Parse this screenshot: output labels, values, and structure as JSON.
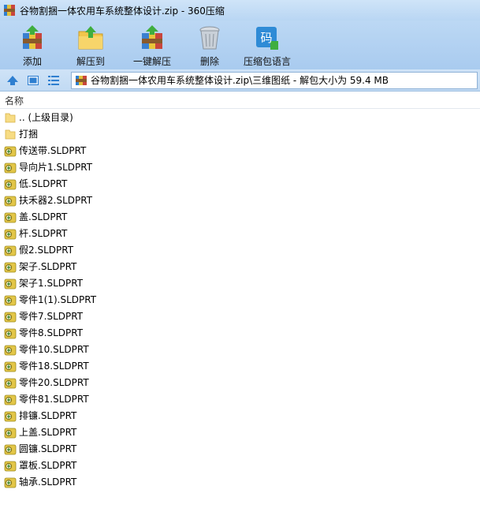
{
  "window": {
    "title": "谷物割捆一体农用车系统整体设计.zip - 360压缩"
  },
  "toolbar": {
    "buttons": [
      {
        "label": "添加",
        "icon": "add-archive-icon"
      },
      {
        "label": "解压到",
        "icon": "extract-to-icon"
      },
      {
        "label": "一键解压",
        "icon": "one-click-extract-icon"
      },
      {
        "label": "删除",
        "icon": "delete-trash-icon"
      },
      {
        "label": "压缩包语言",
        "icon": "archive-language-icon"
      }
    ],
    "language_icon_text": "码"
  },
  "address": {
    "path": "谷物割捆一体农用车系统整体设计.zip\\三维图纸 - 解包大小为 59.4 MB"
  },
  "list": {
    "column_name": "名称",
    "items": [
      {
        "name": ".. (上级目录)",
        "type": "folder"
      },
      {
        "name": "打捆",
        "type": "folder"
      },
      {
        "name": "传送带.SLDPRT",
        "type": "file"
      },
      {
        "name": "导向片1.SLDPRT",
        "type": "file"
      },
      {
        "name": "低.SLDPRT",
        "type": "file"
      },
      {
        "name": "扶禾器2.SLDPRT",
        "type": "file"
      },
      {
        "name": "盖.SLDPRT",
        "type": "file"
      },
      {
        "name": "杆.SLDPRT",
        "type": "file"
      },
      {
        "name": "假2.SLDPRT",
        "type": "file"
      },
      {
        "name": "架子.SLDPRT",
        "type": "file"
      },
      {
        "name": "架子1.SLDPRT",
        "type": "file"
      },
      {
        "name": "零件1(1).SLDPRT",
        "type": "file"
      },
      {
        "name": "零件7.SLDPRT",
        "type": "file"
      },
      {
        "name": "零件8.SLDPRT",
        "type": "file"
      },
      {
        "name": "零件10.SLDPRT",
        "type": "file"
      },
      {
        "name": "零件18.SLDPRT",
        "type": "file"
      },
      {
        "name": "零件20.SLDPRT",
        "type": "file"
      },
      {
        "name": "零件81.SLDPRT",
        "type": "file"
      },
      {
        "name": "排镰.SLDPRT",
        "type": "file"
      },
      {
        "name": "上盖.SLDPRT",
        "type": "file"
      },
      {
        "name": "圆镰.SLDPRT",
        "type": "file"
      },
      {
        "name": "罩板.SLDPRT",
        "type": "file"
      },
      {
        "name": "轴承.SLDPRT",
        "type": "file"
      }
    ]
  }
}
